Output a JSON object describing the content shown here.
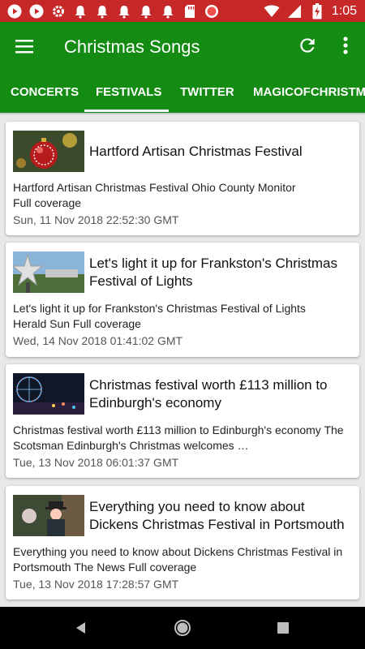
{
  "status_bar": {
    "left_icons": [
      "youtube-icon",
      "play-icon",
      "settings-icon",
      "notification-icon",
      "notification-icon",
      "notification-icon",
      "notification-icon",
      "notification-icon",
      "sd-card-icon",
      "record-icon"
    ],
    "time": "1:05"
  },
  "app_bar": {
    "title": "Christmas Songs"
  },
  "tabs": [
    {
      "label": "CONCERTS"
    },
    {
      "label": "FESTIVALS"
    },
    {
      "label": "TWITTER"
    },
    {
      "label": "MAGICOFCHRISTMAS"
    }
  ],
  "selected_tab": "FESTIVALS",
  "articles": [
    {
      "title": "Hartford Artisan Christmas Festival",
      "description": "Hartford Artisan Christmas Festival  Ohio County Monitor\nFull coverage",
      "date": "Sun, 11 Nov 2018 22:52:30 GMT"
    },
    {
      "title": "Let's light it up for Frankston's Christmas Festival of Lights",
      "description": "Let's light it up for Frankston's Christmas Festival of Lights\nHerald Sun  Full coverage",
      "date": "Wed, 14 Nov 2018 01:41:02 GMT"
    },
    {
      "title": "Christmas festival worth £113 million to Edinburgh's economy",
      "description": "Christmas festival worth £113 million to Edinburgh's economy  The Scotsman  Edinburgh's Christmas welcomes …",
      "date": "Tue, 13 Nov 2018 06:01:37 GMT"
    },
    {
      "title": "Everything you need to know about Dickens Christmas Festival in Portsmouth",
      "description": "Everything you need to know about Dickens Christmas Festival in Portsmouth  The News  Full coverage",
      "date": "Tue, 13 Nov 2018 17:28:57 GMT"
    }
  ],
  "colors": {
    "status_bar": "#c62828",
    "app_bar": "#148c14",
    "background": "#e8e8e8"
  }
}
